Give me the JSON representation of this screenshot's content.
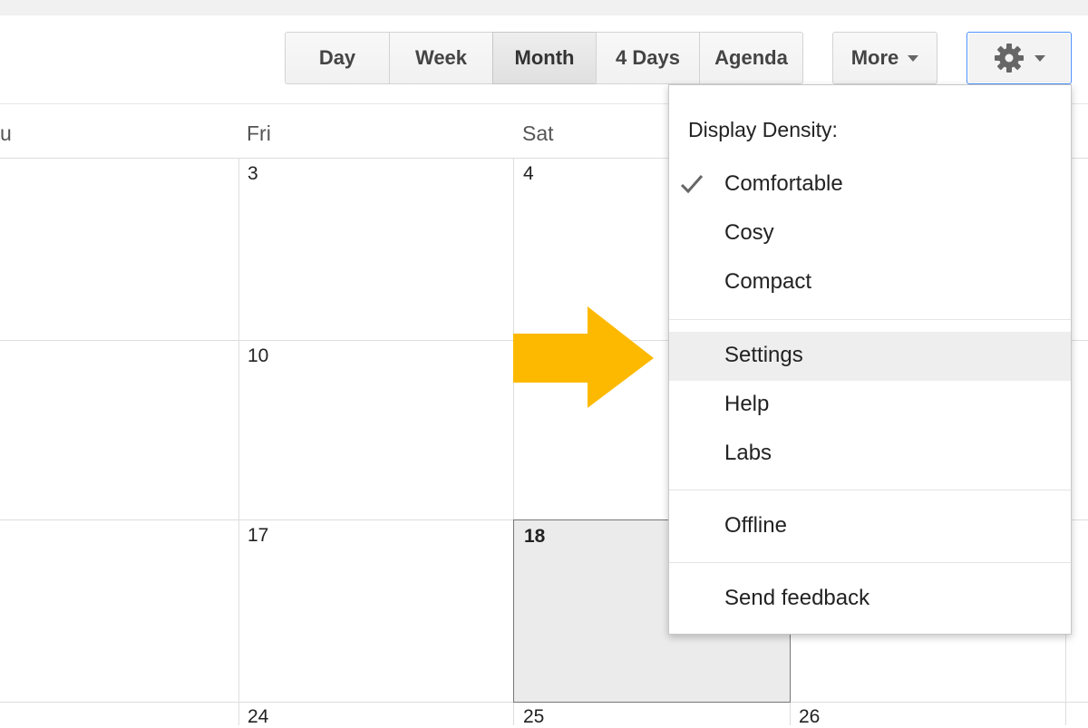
{
  "toolbar": {
    "views": [
      "Day",
      "Week",
      "Month",
      "4 Days",
      "Agenda"
    ],
    "active_view": "Month",
    "more_label": "More",
    "settings_icon": "gear-icon"
  },
  "calendar": {
    "day_headers": [
      "u",
      "Fri",
      "Sat"
    ],
    "rows": [
      {
        "fri": "3",
        "sat": "4",
        "sun": ""
      },
      {
        "fri": "10",
        "sat": "",
        "sun": ""
      },
      {
        "fri": "17",
        "sat": "18",
        "sun": ""
      },
      {
        "fri": "24",
        "sat": "25",
        "sun": "26"
      }
    ],
    "today": "18"
  },
  "settings_menu": {
    "density_header": "Display Density:",
    "density_options": [
      "Comfortable",
      "Cosy",
      "Compact"
    ],
    "selected_density": "Comfortable",
    "items": [
      "Settings",
      "Help",
      "Labs"
    ],
    "offline": "Offline",
    "feedback": "Send feedback",
    "highlighted_item": "Settings"
  },
  "colors": {
    "arrow": "#fdb900",
    "focus_border": "#4d90fe",
    "today_bg": "#ebebeb",
    "menu_hover": "#eeeeee"
  }
}
